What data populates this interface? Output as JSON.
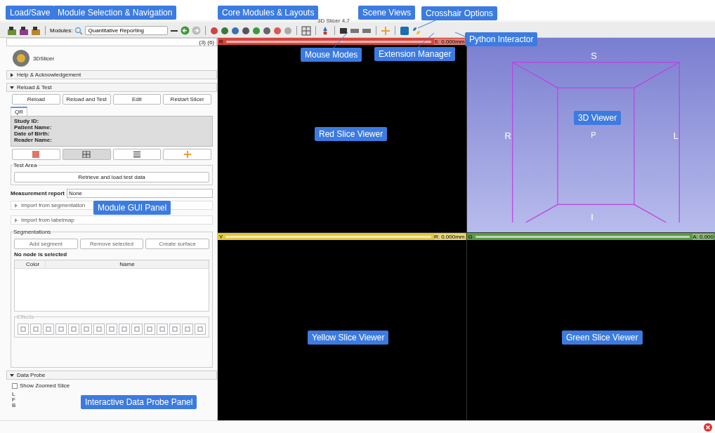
{
  "window": {
    "title": "3D Slicer 4.7"
  },
  "toolbar": {
    "modules_label": "Modules:",
    "module_select": "Quantitative Reporting"
  },
  "module_panel": {
    "search_count": "(3) (6)",
    "logo_text": "3DSlicer",
    "sections": [
      {
        "label": "Help & Acknowledgement",
        "expanded": false
      },
      {
        "label": "Reload & Test",
        "expanded": true
      }
    ],
    "reload_buttons": [
      "Reload",
      "Reload and Test",
      "Edit",
      "Restart Slicer"
    ],
    "tabs": [
      {
        "label": "QR",
        "selected": true
      }
    ],
    "info_fields": [
      "Study ID:",
      "Patient Name:",
      "Date of Birth:",
      "Reader Name:"
    ],
    "layout_buttons": [
      {
        "kind": "red",
        "selected": false
      },
      {
        "kind": "grid",
        "selected": true
      },
      {
        "kind": "table",
        "selected": false
      },
      {
        "kind": "cross",
        "selected": false
      }
    ],
    "test_area": {
      "title": "Test Area",
      "button": "Retrieve and load test data"
    },
    "measurement_report": {
      "label": "Measurement report",
      "value": "None"
    },
    "collapsibles": [
      {
        "label": "Import from segmentation",
        "expanded": false
      },
      {
        "label": "Import from labelmap",
        "expanded": false
      }
    ],
    "segmentations": {
      "title": "Segmentations",
      "buttons": [
        "Add segment",
        "Remove selected",
        "Create surface"
      ],
      "status": "No node is selected",
      "columns": [
        "Color",
        "Name"
      ]
    },
    "effects": {
      "title": "Effects"
    },
    "data_probe": {
      "label": "Data Probe",
      "expanded": true,
      "show_zoomed": {
        "label": "Show Zoomed Slice",
        "checked": false
      },
      "coords": [
        "L",
        "F",
        "B"
      ]
    }
  },
  "views": [
    {
      "kind": "slice",
      "label": "R",
      "offset": "S: 0.000mm",
      "color": "#d8453c"
    },
    {
      "kind": "volume",
      "marks": [
        "S",
        "R",
        "P",
        "L",
        "I"
      ]
    },
    {
      "kind": "slice",
      "label": "Y",
      "offset": "R: 0.000mm",
      "color": "#e3c83c"
    },
    {
      "kind": "slice",
      "label": "G",
      "offset": "A: 0.000",
      "color": "#5a9b44"
    }
  ],
  "callouts": [
    "Load/Save",
    "Module Selection & Navigation",
    "Core Modules & Layouts",
    "Scene Views",
    "Crosshair Options",
    "Python Interactor",
    "Mouse Modes",
    "Extension Manager",
    "Red Slice Viewer",
    "3D Viewer",
    "Module GUI Panel",
    "Yellow Slice Viewer",
    "Green Slice Viewer",
    "Interactive Data Probe Panel"
  ]
}
